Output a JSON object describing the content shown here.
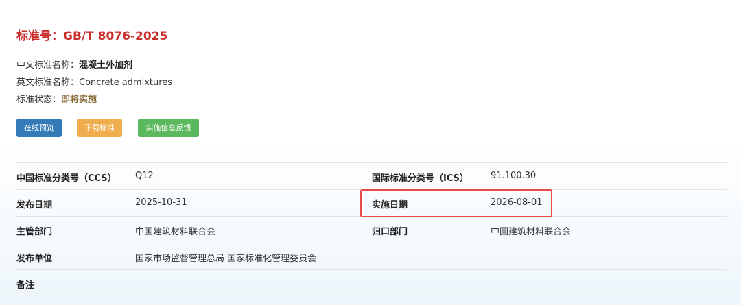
{
  "header": {
    "title": "标准号：GB/T 8076-2025"
  },
  "info": {
    "cn_name_label": "中文标准名称：",
    "cn_name_value": "混凝土外加剂",
    "en_name_label": "英文标准名称：",
    "en_name_value": "Concrete admixtures",
    "status_label": "标准状态：",
    "status_value": "即将实施"
  },
  "buttons": {
    "preview": "在线预览",
    "download": "下载标准",
    "feedback": "实施信息反馈"
  },
  "table": {
    "rows": [
      {
        "l1": "中国标准分类号（CCS）",
        "v1": "Q12",
        "l2": "国际标准分类号（ICS）",
        "v2": "91.100.30"
      },
      {
        "l1": "发布日期",
        "v1": "2025-10-31",
        "l2": "实施日期",
        "v2": "2026-08-01"
      },
      {
        "l1": "主管部门",
        "v1": "中国建筑材料联合会",
        "l2": "归口部门",
        "v2": "中国建筑材料联合会"
      },
      {
        "l1": "发布单位",
        "v1": "国家市场监督管理总局 国家标准化管理委员会",
        "l2": "",
        "v2": ""
      },
      {
        "l1": "备注",
        "v1": "",
        "l2": "",
        "v2": ""
      }
    ]
  },
  "colors": {
    "title": "#c9302c",
    "status": "#8a6d3b",
    "btn_blue": "#337ab7",
    "btn_orange": "#f0ad4e",
    "btn_green": "#5cb85c",
    "highlight_border": "#e84a4a"
  }
}
